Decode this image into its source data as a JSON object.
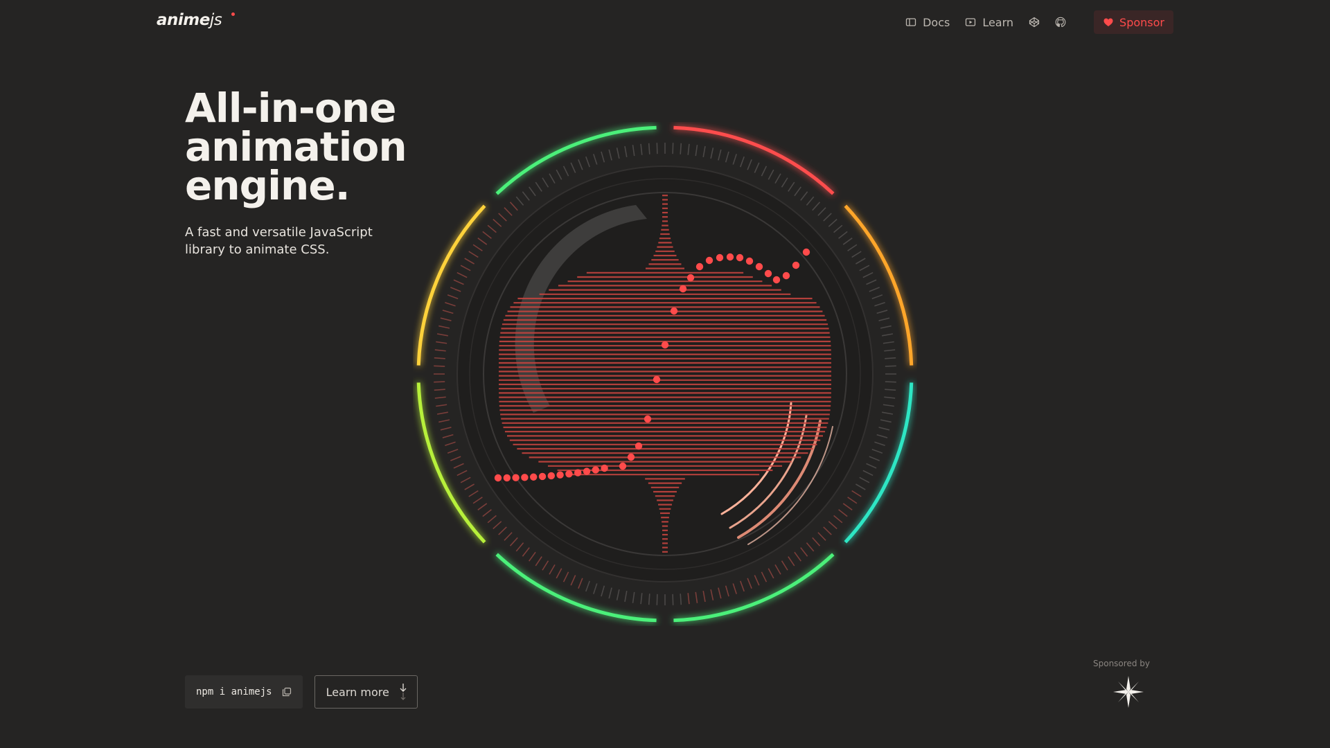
{
  "brand": {
    "logo_main": "anime",
    "logo_suffix": "js"
  },
  "nav": {
    "docs_label": "Docs",
    "learn_label": "Learn",
    "sponsor_label": "Sponsor"
  },
  "icons": {
    "docs": "book-icon",
    "learn": "play-icon",
    "codepen": "codepen-icon",
    "github": "github-icon",
    "heart": "heart-icon",
    "copy": "copy-icon",
    "arrow": "arrow-down-icon",
    "sponsor": "star-burst-logo-icon"
  },
  "hero": {
    "title_lines": [
      "All-in-one",
      "animation",
      "engine."
    ],
    "subtitle": "A fast and versatile JavaScript library to animate CSS."
  },
  "actions": {
    "npm_command": "npm i animejs",
    "learn_more_label": "Learn more"
  },
  "sponsor_section": {
    "label": "Sponsored by"
  },
  "colors": {
    "background": "#252423",
    "accent_red": "#ff4b4b",
    "ring_red": "#ff4d4d",
    "ring_orange": "#ffa62b",
    "ring_teal": "#2ee6c4",
    "ring_green": "#4cf07a",
    "ring_lime": "#b7f03a",
    "ring_yellow": "#ffd23a",
    "peach": "#ffb29a"
  }
}
